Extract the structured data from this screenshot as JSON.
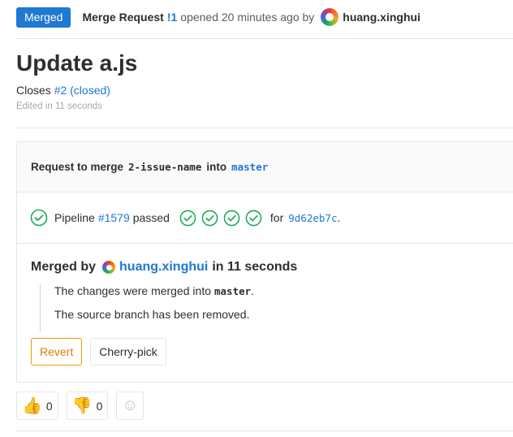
{
  "header": {
    "status_badge": "Merged",
    "mr_label": "Merge Request",
    "mr_id": "!1",
    "opened_text": "opened 20 minutes ago by",
    "author": "huang.xinghui"
  },
  "issue": {
    "title": "Update a.js",
    "closes_label": "Closes",
    "closes_link": "#2 (closed)",
    "edited": "Edited in 11 seconds"
  },
  "widget": {
    "request_label": "Request to merge",
    "source_branch": "2-issue-name",
    "into_label": "into",
    "target_branch": "master",
    "pipeline": {
      "label": "Pipeline",
      "id": "#1579",
      "status": "passed",
      "stages": [
        "passed",
        "passed",
        "passed",
        "passed"
      ],
      "for_label": "for",
      "sha": "9d62eb7c",
      "sha_suffix": "."
    },
    "merged": {
      "by_label": "Merged by",
      "author": "huang.xinghui",
      "time_label": "in 11 seconds",
      "msg1_prefix": "The changes were merged into",
      "msg1_branch": "master",
      "msg1_suffix": ".",
      "msg2": "The source branch has been removed."
    },
    "buttons": {
      "revert": "Revert",
      "cherry_pick": "Cherry-pick"
    }
  },
  "awards": {
    "thumbsup_glyph": "👍",
    "thumbsup_count": "0",
    "thumbsdown_glyph": "👎",
    "thumbsdown_count": "0",
    "add_glyph": "☺"
  },
  "colors": {
    "accent": "#1f78d1",
    "success": "#1aaa55",
    "revert": "#fc9403"
  }
}
